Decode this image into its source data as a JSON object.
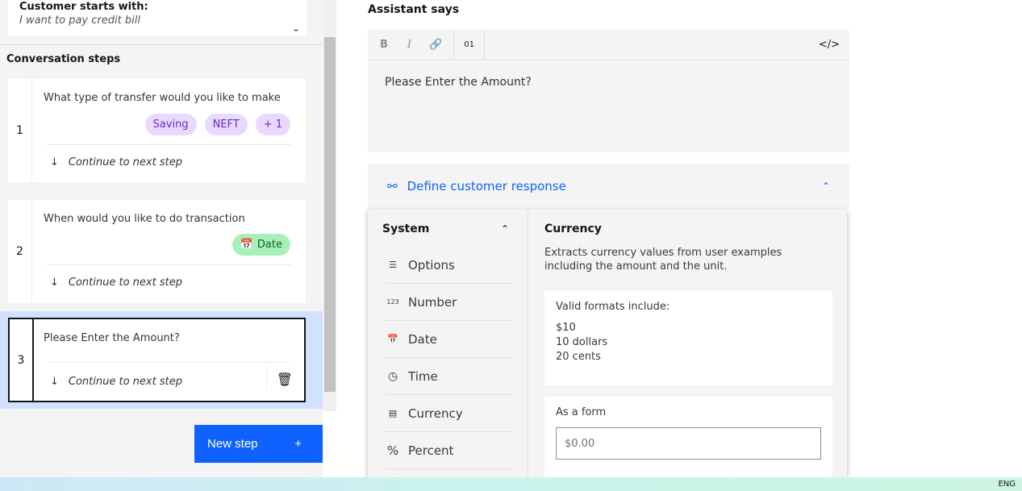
{
  "left": {
    "starts_title": "Customer starts with:",
    "starts_value": "I want to pay credit bill",
    "conversation_title": "Conversation steps",
    "steps": [
      {
        "number": "1",
        "question": "What type of transfer would you like to make",
        "tags": [
          "Saving",
          "NEFT",
          "+ 1"
        ],
        "next": "Continue to next step"
      },
      {
        "number": "2",
        "question": "When would you like to do transaction",
        "tags": [
          "Date"
        ],
        "next": "Continue to next step"
      },
      {
        "number": "3",
        "question": "Please Enter the Amount?",
        "next": "Continue to next step"
      }
    ],
    "new_step": "New step",
    "new_step_icon": "+"
  },
  "right": {
    "assistant_says": "Assistant says",
    "toolbar": {
      "bold": "B",
      "italic": "I",
      "code": "</>"
    },
    "editor_text": "Please Enter the Amount?",
    "define_response": "Define customer response"
  },
  "menu": {
    "header": "System",
    "items": [
      "Options",
      "Number",
      "Date",
      "Time",
      "Currency",
      "Percent"
    ],
    "detail": {
      "title": "Currency",
      "description": "Extracts currency values from user examples including the amount and the unit.",
      "formats_label": "Valid formats include:",
      "formats": [
        "$10",
        "10 dollars",
        "20 cents"
      ],
      "form_label": "As a form",
      "form_placeholder": "$0.00"
    }
  },
  "taskbar": {
    "lang": "ENG"
  },
  "colors": {
    "accent": "#0f62fe",
    "selected_bg": "#d0e2ff",
    "tag_purple": "#e8daff",
    "tag_green": "#a7f0ba"
  }
}
